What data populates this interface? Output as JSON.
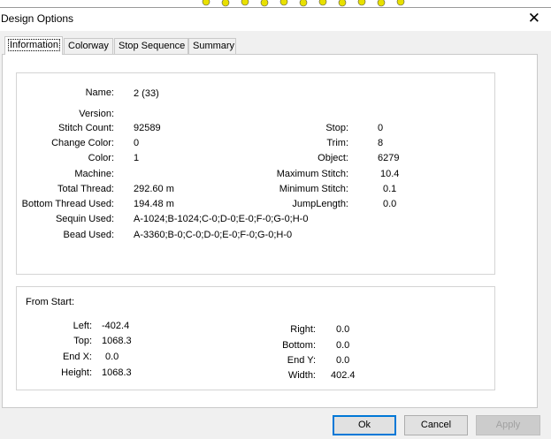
{
  "dialog": {
    "title": "Design Options",
    "close_glyph": "✕"
  },
  "tabs": [
    {
      "label": "Information",
      "active": true
    },
    {
      "label": "Colorway",
      "active": false
    },
    {
      "label": "Stop Sequence",
      "active": false
    },
    {
      "label": "Summary",
      "active": false
    }
  ],
  "info": {
    "name": {
      "label": "Name:",
      "value": "2 (33)"
    },
    "version": {
      "label": "Version:",
      "value": ""
    },
    "stitch_count": {
      "label": "Stitch Count:",
      "value": "92589"
    },
    "change_color": {
      "label": "Change Color:",
      "value": "0"
    },
    "color": {
      "label": "Color:",
      "value": "1"
    },
    "machine": {
      "label": "Machine:",
      "value": ""
    },
    "total_thread": {
      "label": "Total Thread:",
      "value": "292.60 m"
    },
    "bottom_thread": {
      "label": "Bottom Thread Used:",
      "value": "194.48 m"
    },
    "sequin": {
      "label": "Sequin Used:",
      "value": "A-1024;B-1024;C-0;D-0;E-0;F-0;G-0;H-0"
    },
    "bead": {
      "label": "Bead Used:",
      "value": "A-3360;B-0;C-0;D-0;E-0;F-0;G-0;H-0"
    },
    "stop": {
      "label": "Stop:",
      "value": "0"
    },
    "trim": {
      "label": "Trim:",
      "value": "8"
    },
    "object": {
      "label": "Object:",
      "value": "6279"
    },
    "max_stitch": {
      "label": "Maximum Stitch:",
      "value": "10.4"
    },
    "min_stitch": {
      "label": "Minimum Stitch:",
      "value": "0.1"
    },
    "jump_length": {
      "label": "JumpLength:",
      "value": "0.0"
    }
  },
  "from_start": {
    "heading": "From Start:",
    "left": {
      "label": "Left:",
      "value": "-402.4"
    },
    "top": {
      "label": "Top:",
      "value": "1068.3"
    },
    "end_x": {
      "label": "End X:",
      "value": "0.0"
    },
    "height": {
      "label": "Height:",
      "value": "1068.3"
    },
    "right": {
      "label": "Right:",
      "value": "0.0"
    },
    "bottom": {
      "label": "Bottom:",
      "value": "0.0"
    },
    "end_y": {
      "label": "End Y:",
      "value": "0.0"
    },
    "width": {
      "label": "Width:",
      "value": "402.4"
    }
  },
  "buttons": {
    "ok": "Ok",
    "cancel": "Cancel",
    "apply": "Apply"
  },
  "colors": {
    "accent": "#0078d7",
    "decoration": "#e8e000"
  }
}
